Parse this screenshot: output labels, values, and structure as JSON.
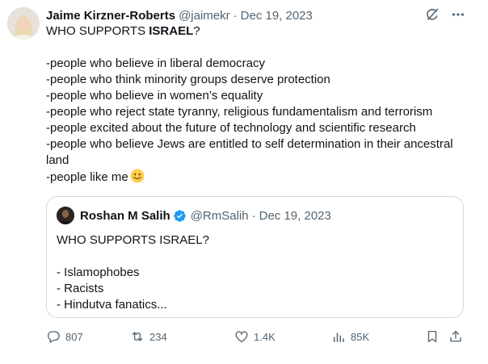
{
  "tweet": {
    "author_name": "Jaime Kirzner-Roberts",
    "handle": "@jaimekr",
    "separator": "·",
    "date": "Dec 19, 2023",
    "text_intro_start": "WHO SUPPORTS ",
    "text_intro_bold": "ISRAEL",
    "text_intro_end": "?",
    "lines": [
      "-people who believe in liberal democracy",
      "-people who think minority groups deserve protection",
      "-people who believe in women’s equality",
      "-people who reject state tyranny, religious fundamentalism and terrorism",
      "-people excited about the future of technology and scientific research",
      "-people who believe Jews are entitled to self determination in their ancestral land",
      "-people like me"
    ],
    "emoji": "slightly-smiling-face"
  },
  "quote": {
    "author_name": "Roshan M Salih",
    "handle": "@RmSalih",
    "separator": "·",
    "date": "Dec 19, 2023",
    "title": "WHO SUPPORTS ISRAEL?",
    "lines": [
      "- Islamophobes",
      "- Racists",
      "- Hindutva fanatics..."
    ]
  },
  "actions": {
    "replies": "807",
    "reposts": "234",
    "likes": "1.4K",
    "views": "85K"
  },
  "icons": {
    "top_right": [
      "grok-icon",
      "more-icon"
    ],
    "actions": [
      "reply-icon",
      "repost-icon",
      "like-icon",
      "views-icon",
      "bookmark-icon",
      "share-icon"
    ]
  },
  "colors": {
    "text": "#0f1419",
    "secondary": "#536471",
    "border": "#cfd9de",
    "verified": "#1d9bf0"
  }
}
